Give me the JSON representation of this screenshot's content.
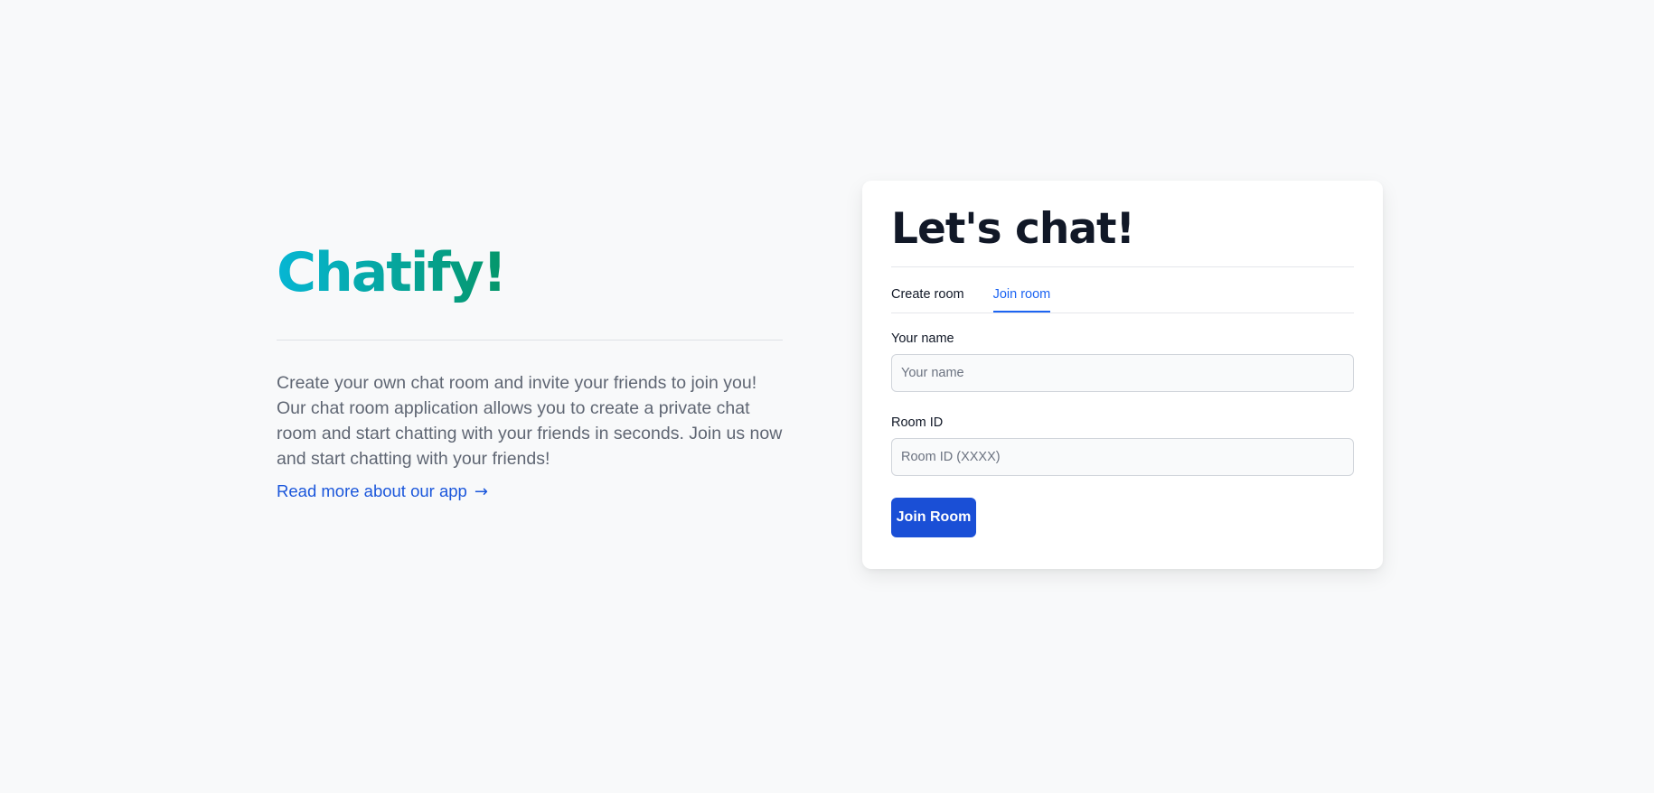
{
  "hero": {
    "brand": "Chatify!",
    "description": "Create your own chat room and invite your friends to join you! Our chat room application allows you to create a private chat room and start chatting with your friends in seconds. Join us now and start chatting with your friends!",
    "link_label": "Read more about our app",
    "link_arrow": "→",
    "brand_gradient": [
      "#06b6d4",
      "#059669"
    ],
    "link_color": "#1a56db"
  },
  "card": {
    "title": "Let's chat!",
    "tabs": [
      {
        "label": "Create room",
        "active": false
      },
      {
        "label": "Join room",
        "active": true
      }
    ],
    "fields": [
      {
        "label": "Your name",
        "value": "",
        "placeholder": "Your name"
      },
      {
        "label": "Room ID",
        "value": "",
        "placeholder": "Room ID (XXXX)"
      }
    ],
    "submit_label": "Join Room",
    "accent_color": "#1c64f2",
    "button_color": "#1a4fd6"
  }
}
